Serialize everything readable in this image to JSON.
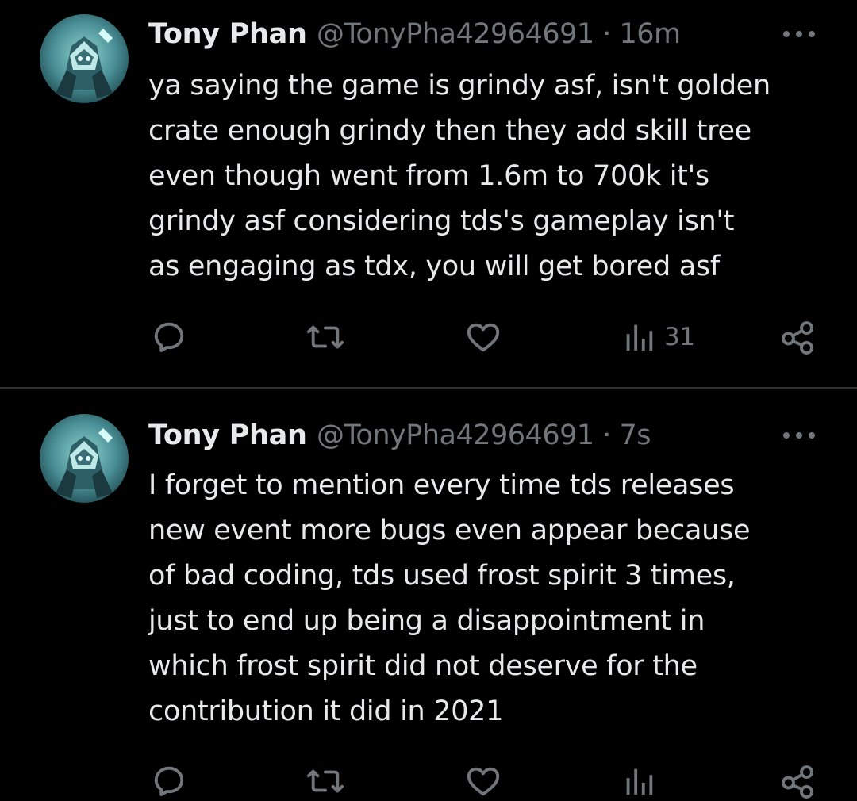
{
  "colors": {
    "background": "#000000",
    "text_primary": "#e7e9ea",
    "text_secondary": "#71767b",
    "divider": "#2f3336"
  },
  "tweets": [
    {
      "author_name": "Tony Phan",
      "meta": "@TonyPha42964691 · 16m",
      "text": "ya saying the game is grindy asf, isn't golden\ncrate enough grindy then they add skill tree\neven though went from 1.6m to 700k it's\ngrindy asf considering tds's gameplay isn't\nas engaging as tdx, you will get bored asf",
      "views": "31",
      "icons": [
        "reply-icon",
        "retweet-icon",
        "like-icon",
        "views-icon",
        "share-icon",
        "more-icon"
      ]
    },
    {
      "author_name": "Tony Phan",
      "meta": "@TonyPha42964691 · 7s",
      "text": "I forget to mention every time tds releases\nnew event more bugs even appear because\nof bad coding, tds used frost spirit 3 times,\njust to end up being a disappointment in\nwhich frost spirit did not deserve for the\ncontribution it did in 2021",
      "views": "",
      "icons": [
        "reply-icon",
        "retweet-icon",
        "like-icon",
        "views-icon",
        "share-icon",
        "more-icon"
      ]
    }
  ]
}
